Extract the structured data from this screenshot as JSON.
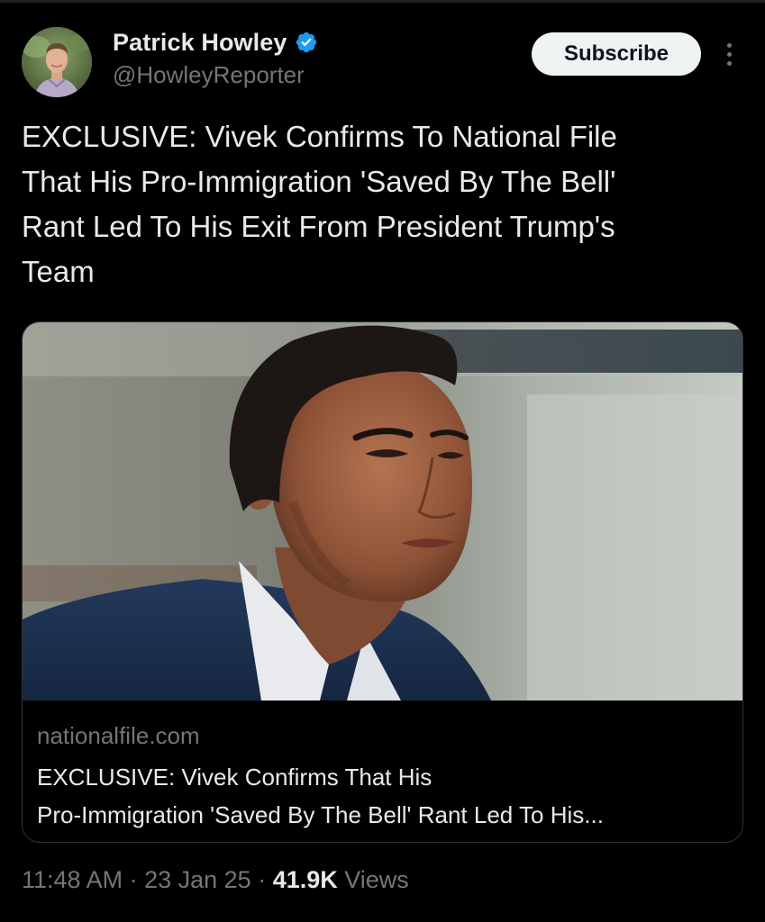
{
  "author": {
    "display_name": "Patrick Howley",
    "handle": "@HowleyReporter",
    "verified": true,
    "avatar_icon": "profile-photo"
  },
  "actions": {
    "subscribe_label": "Subscribe",
    "more_icon": "more-vertical-icon"
  },
  "tweet": {
    "text": "EXCLUSIVE: Vivek Confirms To National File\nThat His Pro-Immigration 'Saved By The Bell'\nRant Led To His Exit From President Trump's\nTeam"
  },
  "link_card": {
    "image_icon": "article-photo-portrait",
    "domain": "nationalfile.com",
    "title": "EXCLUSIVE: Vivek Confirms That His\nPro-Immigration 'Saved By The Bell' Rant Led To His..."
  },
  "meta": {
    "time": "11:48 AM",
    "separator": " · ",
    "date": "23 Jan 25",
    "views_count": "41.9K",
    "views_label": " Views"
  },
  "colors": {
    "background": "#000000",
    "text_primary": "#e7e9ea",
    "text_secondary": "#71767b",
    "verified_blue": "#1d9bf0",
    "button_bg": "#eff3f4",
    "card_border": "#2f3336"
  }
}
